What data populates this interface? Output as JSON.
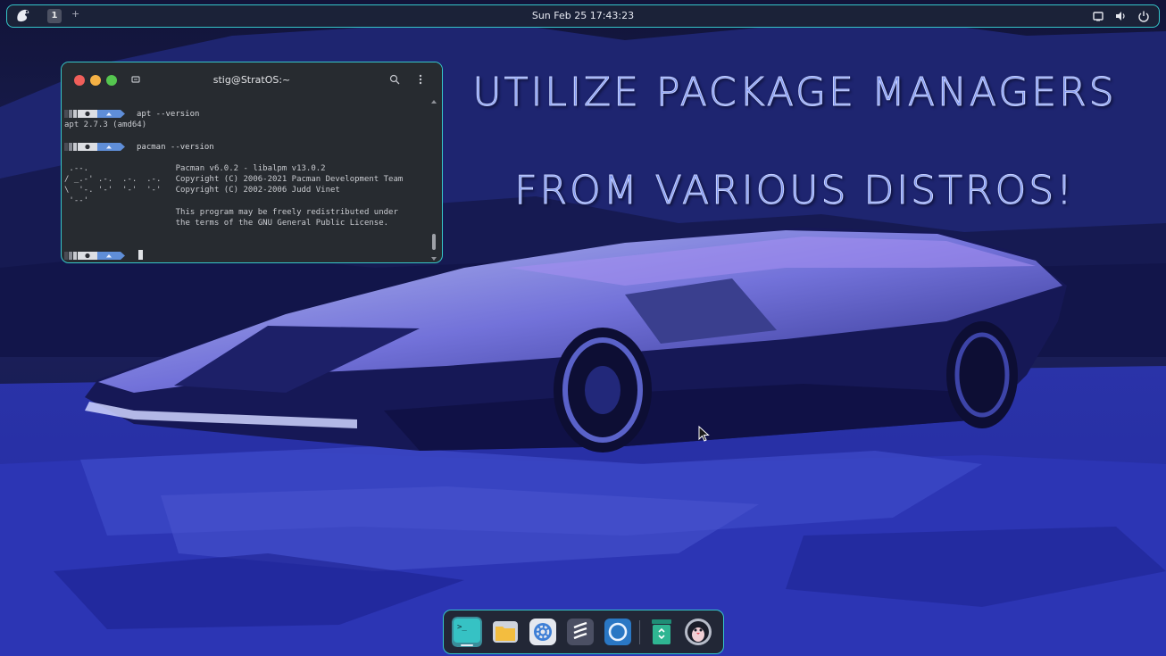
{
  "topbar": {
    "workspace_number": "1",
    "add_workspace": "+",
    "clock": "Sun Feb 25  17:43:23",
    "icons": [
      "strat-logo-icon",
      "screen-icon",
      "volume-icon",
      "power-icon"
    ]
  },
  "wallpaper": {
    "headline_line1": "UTILIZE PACKAGE MANAGERS",
    "headline_line2": "FROM VARIOUS DISTROS!",
    "accent_color": "#7f95f0"
  },
  "terminal": {
    "title": "stig@StratOS:~",
    "lines": {
      "cmd1": "apt --version",
      "out1": "apt 2.7.3 (amd64)",
      "cmd2": "pacman --version",
      "out2": " .--.                  Pacman v6.0.2 - libalpm v13.0.2",
      "out3": "/ _.-' .-.  .-.  .-.   Copyright (C) 2006-2021 Pacman Development Team",
      "out4": "\\  '-. '-'  '-'  '-'   Copyright (C) 2002-2006 Judd Vinet",
      "out5": " '--'",
      "out6": "                       This program may be freely redistributed under",
      "out7": "                       the terms of the GNU General Public License."
    },
    "colors": {
      "border": "#36c7c9",
      "background": "#272b30"
    }
  },
  "dock": {
    "items": [
      {
        "name": "terminal",
        "icon": "terminal-icon"
      },
      {
        "name": "files",
        "icon": "folder-icon"
      },
      {
        "name": "settings",
        "icon": "gear-icon"
      },
      {
        "name": "editor",
        "icon": "text-editor-icon"
      },
      {
        "name": "browser",
        "icon": "browser-icon"
      },
      {
        "name": "trash",
        "icon": "trash-icon"
      },
      {
        "name": "stratos-welcome",
        "icon": "penguin-icon"
      }
    ]
  }
}
